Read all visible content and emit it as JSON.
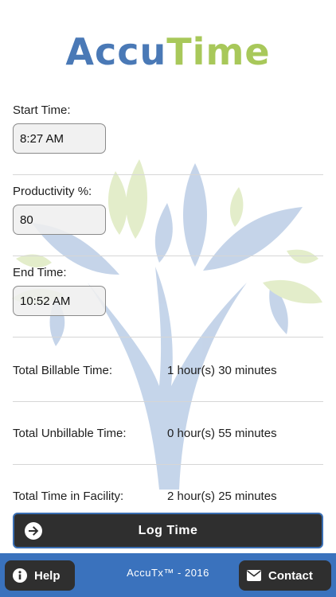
{
  "logo": {
    "part1": "Accu",
    "part2": "Time"
  },
  "fields": [
    {
      "label": "Start Time:",
      "value": "8:27 AM"
    },
    {
      "label": "Productivity %:",
      "value": "80"
    },
    {
      "label": "End Time:",
      "value": "10:52 AM"
    }
  ],
  "stats": [
    {
      "label": "Total Billable Time:",
      "value": "1 hour(s) 30 minutes"
    },
    {
      "label": "Total Unbillable Time:",
      "value": "0 hour(s) 55 minutes"
    },
    {
      "label": "Total Time in Facility:",
      "value": "2 hour(s) 25 minutes"
    }
  ],
  "log_button": {
    "label": "Log Time",
    "icon": "arrow-right-circle-icon"
  },
  "footer": {
    "text": "AccuTx™ - 2016",
    "help_label": "Help",
    "help_icon": "info-icon",
    "contact_label": "Contact",
    "contact_icon": "envelope-icon",
    "bar_color": "#3a72bd"
  },
  "colors": {
    "accent_blue": "#4a79b6",
    "accent_green": "#a8c85a",
    "button_dark": "#2f2f2f"
  }
}
